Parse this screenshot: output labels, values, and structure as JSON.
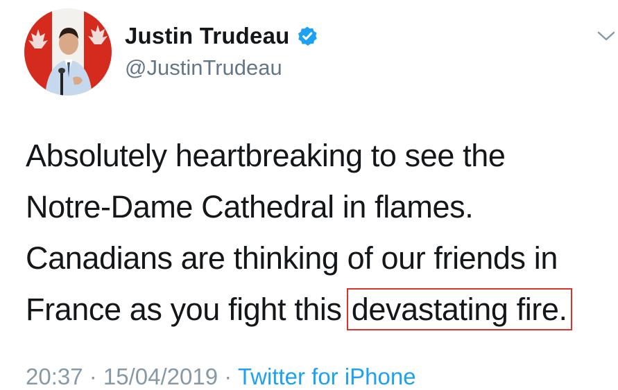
{
  "user": {
    "display_name": "Justin Trudeau",
    "handle": "@JustinTrudeau",
    "verified": true,
    "avatar_icon": "profile-photo-canadian-flag-background"
  },
  "tweet": {
    "lines": [
      "Absolutely heartbreaking to see the",
      "Notre-Dame Cathedral in flames.",
      "Canadians are thinking of our friends in"
    ],
    "last_line_prefix": "France as you fight this ",
    "highlighted_text": "devastating fire.",
    "timestamp": "20:37 · 15/04/2019 ·",
    "source": "Twitter for iPhone"
  },
  "icons": {
    "verified_badge": "verified-badge-icon",
    "menu_caret": "chevron-down-icon"
  },
  "colors": {
    "text_primary": "#14171a",
    "text_secondary": "#657786",
    "verified_blue": "#1da1f2",
    "highlight_box": "#d9342b",
    "flag_red": "#d52b1e"
  }
}
